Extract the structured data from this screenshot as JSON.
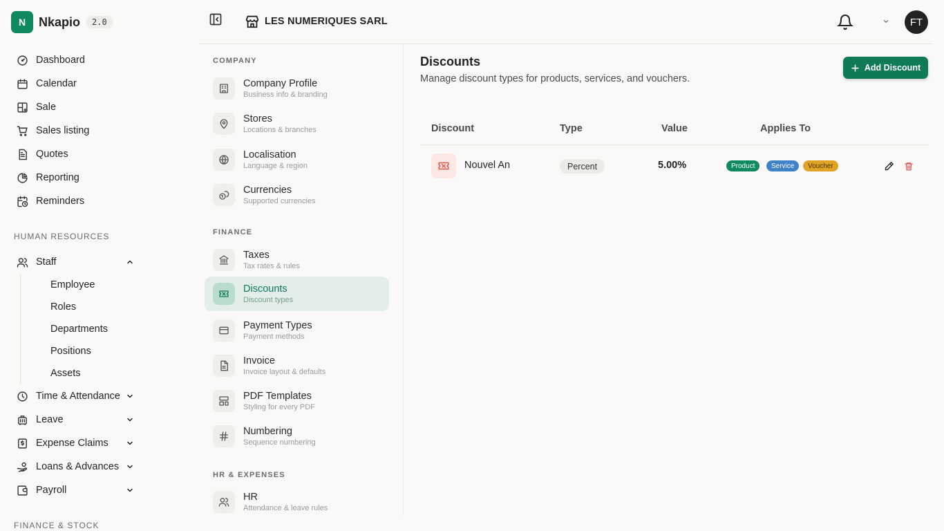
{
  "brand": {
    "logo_letter": "N",
    "name": "Nkapio",
    "version": "2.0"
  },
  "nav": {
    "main": [
      {
        "label": "Dashboard",
        "icon": "dashboard-icon"
      },
      {
        "label": "Calendar",
        "icon": "calendar-icon"
      },
      {
        "label": "Sale",
        "icon": "grid-plus-icon"
      },
      {
        "label": "Sales listing",
        "icon": "cart-icon"
      },
      {
        "label": "Quotes",
        "icon": "document-icon"
      },
      {
        "label": "Reporting",
        "icon": "pie-chart-icon"
      },
      {
        "label": "Reminders",
        "icon": "calendar-clock-icon"
      }
    ],
    "hr_section": "HUMAN RESOURCES",
    "staff": {
      "label": "Staff",
      "children": [
        "Employee",
        "Roles",
        "Departments",
        "Positions",
        "Assets"
      ]
    },
    "hr_items": [
      {
        "label": "Time & Attendance",
        "icon": "clock-icon"
      },
      {
        "label": "Leave",
        "icon": "luggage-icon"
      },
      {
        "label": "Expense Claims",
        "icon": "receipt-icon"
      },
      {
        "label": "Loans & Advances",
        "icon": "hand-coins-icon"
      },
      {
        "label": "Payroll",
        "icon": "wallet-icon"
      }
    ],
    "finance_section": "FINANCE & STOCK"
  },
  "header": {
    "store_name": "LES NUMERIQUES SARL",
    "avatar_initials": "FT"
  },
  "settings_nav": {
    "company_section": "COMPANY",
    "company": [
      {
        "title": "Company Profile",
        "sub": "Business info & branding"
      },
      {
        "title": "Stores",
        "sub": "Locations & branches"
      },
      {
        "title": "Localisation",
        "sub": "Language & region"
      },
      {
        "title": "Currencies",
        "sub": "Supported currencies"
      }
    ],
    "finance_section": "FINANCE",
    "finance": [
      {
        "title": "Taxes",
        "sub": "Tax rates & rules"
      },
      {
        "title": "Discounts",
        "sub": "Discount types"
      },
      {
        "title": "Payment Types",
        "sub": "Payment methods"
      },
      {
        "title": "Invoice",
        "sub": "Invoice layout & defaults"
      },
      {
        "title": "PDF Templates",
        "sub": "Styling for every PDF"
      },
      {
        "title": "Numbering",
        "sub": "Sequence numbering"
      }
    ],
    "hr_section": "HR & EXPENSES",
    "hr": [
      {
        "title": "HR",
        "sub": "Attendance & leave rules"
      }
    ]
  },
  "main": {
    "title": "Discounts",
    "description": "Manage discount types for products, services, and vouchers.",
    "add_button": "Add Discount",
    "columns": [
      "Discount",
      "Type",
      "Value",
      "Applies To"
    ],
    "rows": [
      {
        "name": "Nouvel An",
        "type": "Percent",
        "value": "5.00%",
        "applies_to": [
          "Product",
          "Service",
          "Voucher"
        ]
      }
    ]
  },
  "colors": {
    "accent": "#0f7a56",
    "active_bg": "#e3eee9",
    "tag_product": "#0f8a5f",
    "tag_service": "#3f83c7",
    "tag_voucher": "#e0a323",
    "delete": "#d9534f"
  }
}
